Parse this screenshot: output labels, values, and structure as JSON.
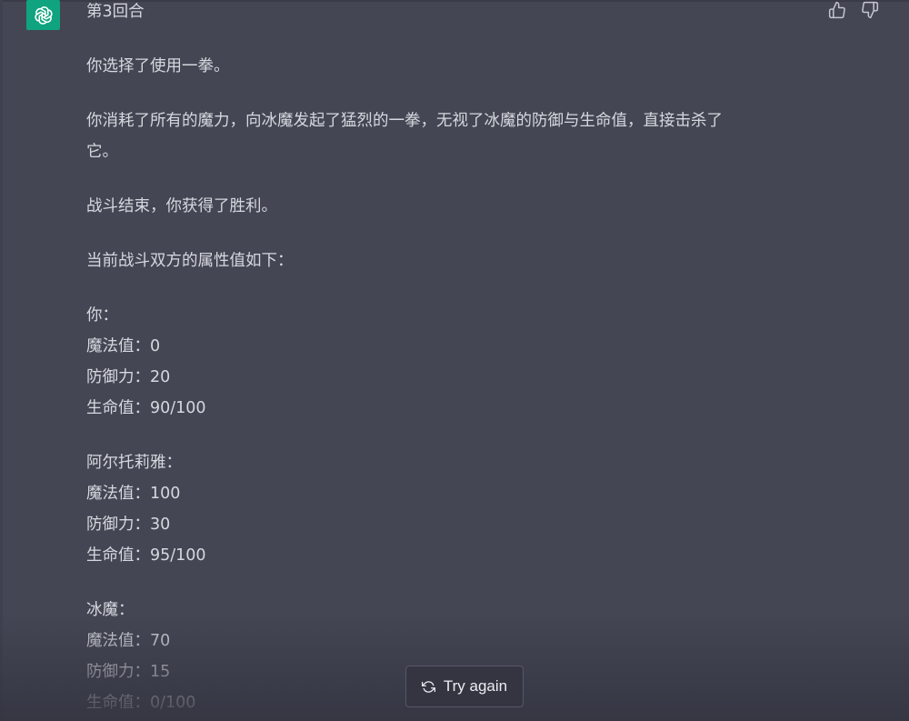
{
  "icons": {
    "assistant_avatar": "openai-logo-icon",
    "thumbs_up": "thumbs-up-icon",
    "thumbs_down": "thumbs-down-icon",
    "regenerate": "refresh-icon"
  },
  "colors": {
    "background": "#444654",
    "avatar_bg": "#10a37f",
    "text": "#d1d5db"
  },
  "message": {
    "round_title": "第3回合",
    "choice": "你选择了使用一拳。",
    "action_line1": "你消耗了所有的魔力，向冰魔发起了猛烈的一拳，无视了冰魔的防御与生命值，直接击杀了",
    "action_line2": "它。",
    "result": "战斗结束，你获得了胜利。",
    "stats_intro": "当前战斗双方的属性值如下：",
    "combatants": [
      {
        "name": "你：",
        "mp": "魔法值：0",
        "def": "防御力：20",
        "hp": "生命值：90/100"
      },
      {
        "name": "阿尔托莉雅：",
        "mp": "魔法值：100",
        "def": "防御力：30",
        "hp": "生命值：95/100"
      },
      {
        "name": "冰魔：",
        "mp": "魔法值：70",
        "def": "防御力：15",
        "hp": "生命值：0/100"
      }
    ]
  },
  "actions": {
    "try_again_label": "Try again"
  }
}
